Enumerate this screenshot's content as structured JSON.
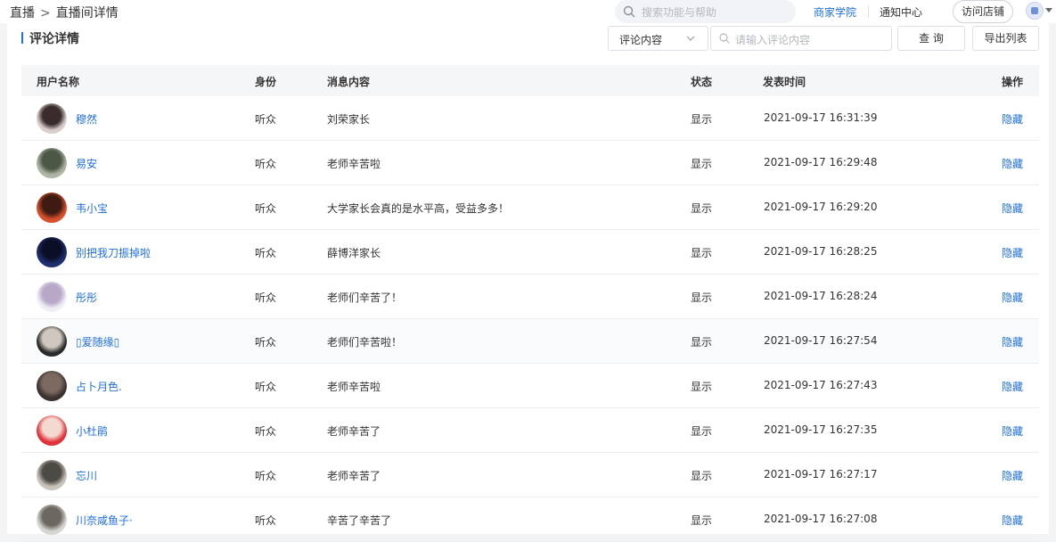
{
  "breadcrumb": {
    "parent": "直播",
    "separator": ">",
    "current": "直播间详情"
  },
  "header": {
    "search_placeholder": "搜索功能与帮助",
    "academy_link": "商家学院",
    "notice_link": "通知中心",
    "visit_store": "访问店铺"
  },
  "page": {
    "title": "评论详情"
  },
  "filters": {
    "select_value": "评论内容",
    "input_placeholder": "请输入评论内容",
    "query_button": "查 询",
    "export_button": "导出列表"
  },
  "table": {
    "columns": [
      "用户名称",
      "身份",
      "消息内容",
      "状态",
      "发表时间",
      "操作"
    ],
    "rows": [
      {
        "name": "穆然",
        "role": "听众",
        "message": "刘荣家长",
        "status": "显示",
        "time": "2021-09-17 16:31:39",
        "action": "隐藏",
        "avatar": [
          "#d9d0cc",
          "#3a2c2c"
        ]
      },
      {
        "name": "易安",
        "role": "听众",
        "message": "老师辛苦啦",
        "status": "显示",
        "time": "2021-09-17 16:29:48",
        "action": "隐藏",
        "avatar": [
          "#aeb5a4",
          "#4d5746"
        ]
      },
      {
        "name": "韦小宝",
        "role": "听众",
        "message": "大学家长会真的是水平高，受益多多！",
        "status": "显示",
        "time": "2021-09-17 16:29:20",
        "action": "隐藏",
        "avatar": [
          "#d8502b",
          "#3d1a12"
        ]
      },
      {
        "name": "别把我刀振掉啦",
        "role": "听众",
        "message": "薛博洋家长",
        "status": "显示",
        "time": "2021-09-17 16:28:25",
        "action": "隐藏",
        "avatar": [
          "#1d2f6e",
          "#0b0f26"
        ]
      },
      {
        "name": "彤彤",
        "role": "听众",
        "message": "老师们辛苦了！",
        "status": "显示",
        "time": "2021-09-17 16:28:24",
        "action": "隐藏",
        "avatar": [
          "#eef0f6",
          "#b9a7c7"
        ]
      },
      {
        "name": "▯爱随缘▯",
        "role": "听众",
        "message": "老师们辛苦啦！",
        "status": "显示",
        "time": "2021-09-17 16:27:54",
        "action": "隐藏",
        "avatar": [
          "#2a2a2a",
          "#d0c8c0"
        ]
      },
      {
        "name": "占卜月色.",
        "role": "听众",
        "message": "老师辛苦啦",
        "status": "显示",
        "time": "2021-09-17 16:27:43",
        "action": "隐藏",
        "avatar": [
          "#3b3330",
          "#7c6a60"
        ]
      },
      {
        "name": "小杜鹃",
        "role": "听众",
        "message": "老师辛苦了",
        "status": "显示",
        "time": "2021-09-17 16:27:35",
        "action": "隐藏",
        "avatar": [
          "#e0323a",
          "#f3d9cf"
        ]
      },
      {
        "name": "忘川",
        "role": "听众",
        "message": "老师辛苦了",
        "status": "显示",
        "time": "2021-09-17 16:27:17",
        "action": "隐藏",
        "avatar": [
          "#c9c4bb",
          "#4c4a45"
        ]
      },
      {
        "name": "川奈咸鱼子·",
        "role": "听众",
        "message": "辛苦了辛苦了",
        "status": "显示",
        "time": "2021-09-17 16:27:08",
        "action": "隐藏",
        "avatar": [
          "#d7d6d2",
          "#6b6761"
        ]
      }
    ]
  },
  "colors": {
    "accent": "#1f6fde",
    "header_bg": "#f5f6f8"
  }
}
